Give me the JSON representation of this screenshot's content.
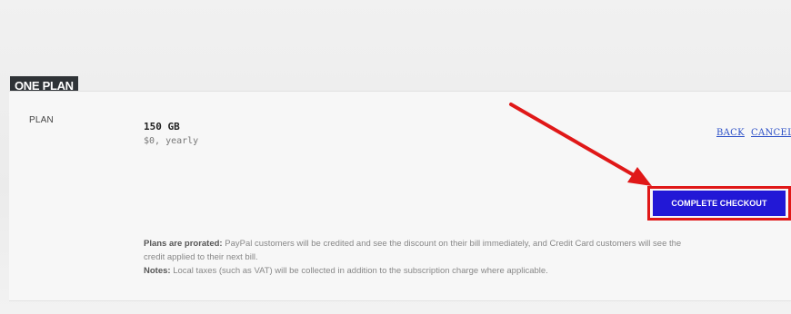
{
  "section": {
    "title": "ONE PLAN"
  },
  "plan": {
    "label": "PLAN",
    "name": "150 GB",
    "price": "$0, yearly"
  },
  "actions": {
    "back_label": "BACK",
    "cancel_label": "CANCEL",
    "complete_checkout_label": "COMPLETE CHECKOUT"
  },
  "notes": {
    "prorated_heading": "Plans are prorated:",
    "prorated_text": " PayPal customers will be credited and see the discount on their bill immediately, and Credit Card customers will see the credit applied to their next bill.",
    "notes_heading": "Notes:",
    "notes_text": " Local taxes (such as VAT) will be collected in addition to the subscription charge where applicable."
  },
  "colors": {
    "accent_button": "#2218d6",
    "highlight_red": "#e01818",
    "link_blue": "#2b4fc7",
    "label_bg": "#2f3337"
  },
  "icons": {
    "annotation": "red-arrow-icon"
  }
}
